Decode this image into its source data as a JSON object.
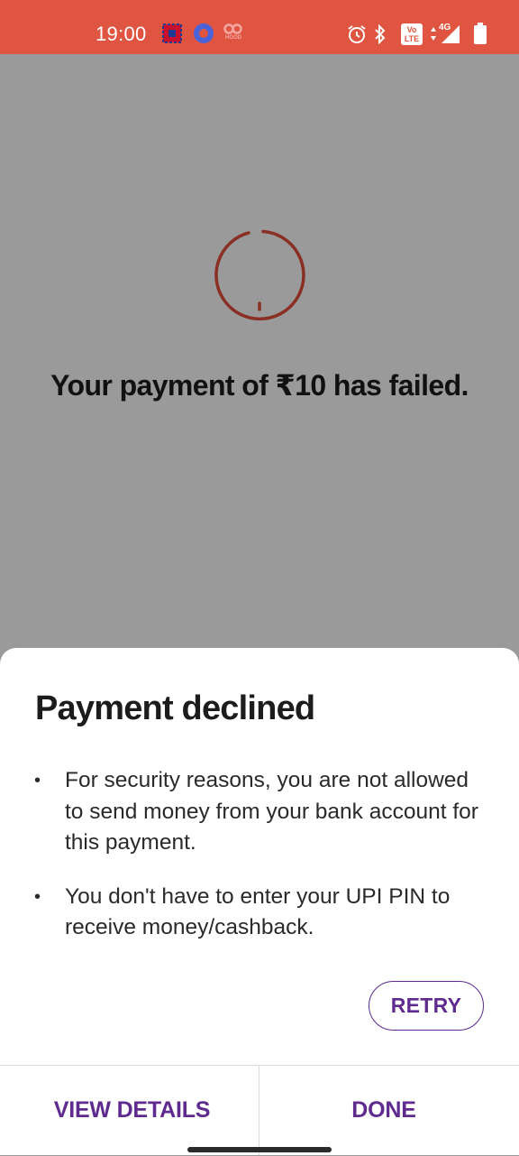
{
  "status_bar": {
    "time": "19:00",
    "icons": [
      "bank-app-icon",
      "settings-app-icon",
      "hood-app-icon",
      "alarm-icon",
      "bluetooth-icon",
      "volte-icon",
      "data-4g-icon",
      "signal-icon",
      "battery-icon"
    ],
    "network_label": "4G",
    "volte_label": "Vo LTE",
    "hood_label": "HOOD",
    "color": "#e05541"
  },
  "payment": {
    "status_message": "Your payment of ₹10 has failed.",
    "spinner_color": "#8a2f24"
  },
  "sheet": {
    "title": "Payment declined",
    "reasons": [
      "For security reasons, you are not allowed to send money from your bank account for this payment.",
      "You don't have to enter your UPI PIN to receive money/cashback."
    ],
    "bullet": "•",
    "retry_label": "RETRY",
    "view_details_label": "VIEW DETAILS",
    "done_label": "DONE",
    "accent_color": "#5f2b8f"
  }
}
